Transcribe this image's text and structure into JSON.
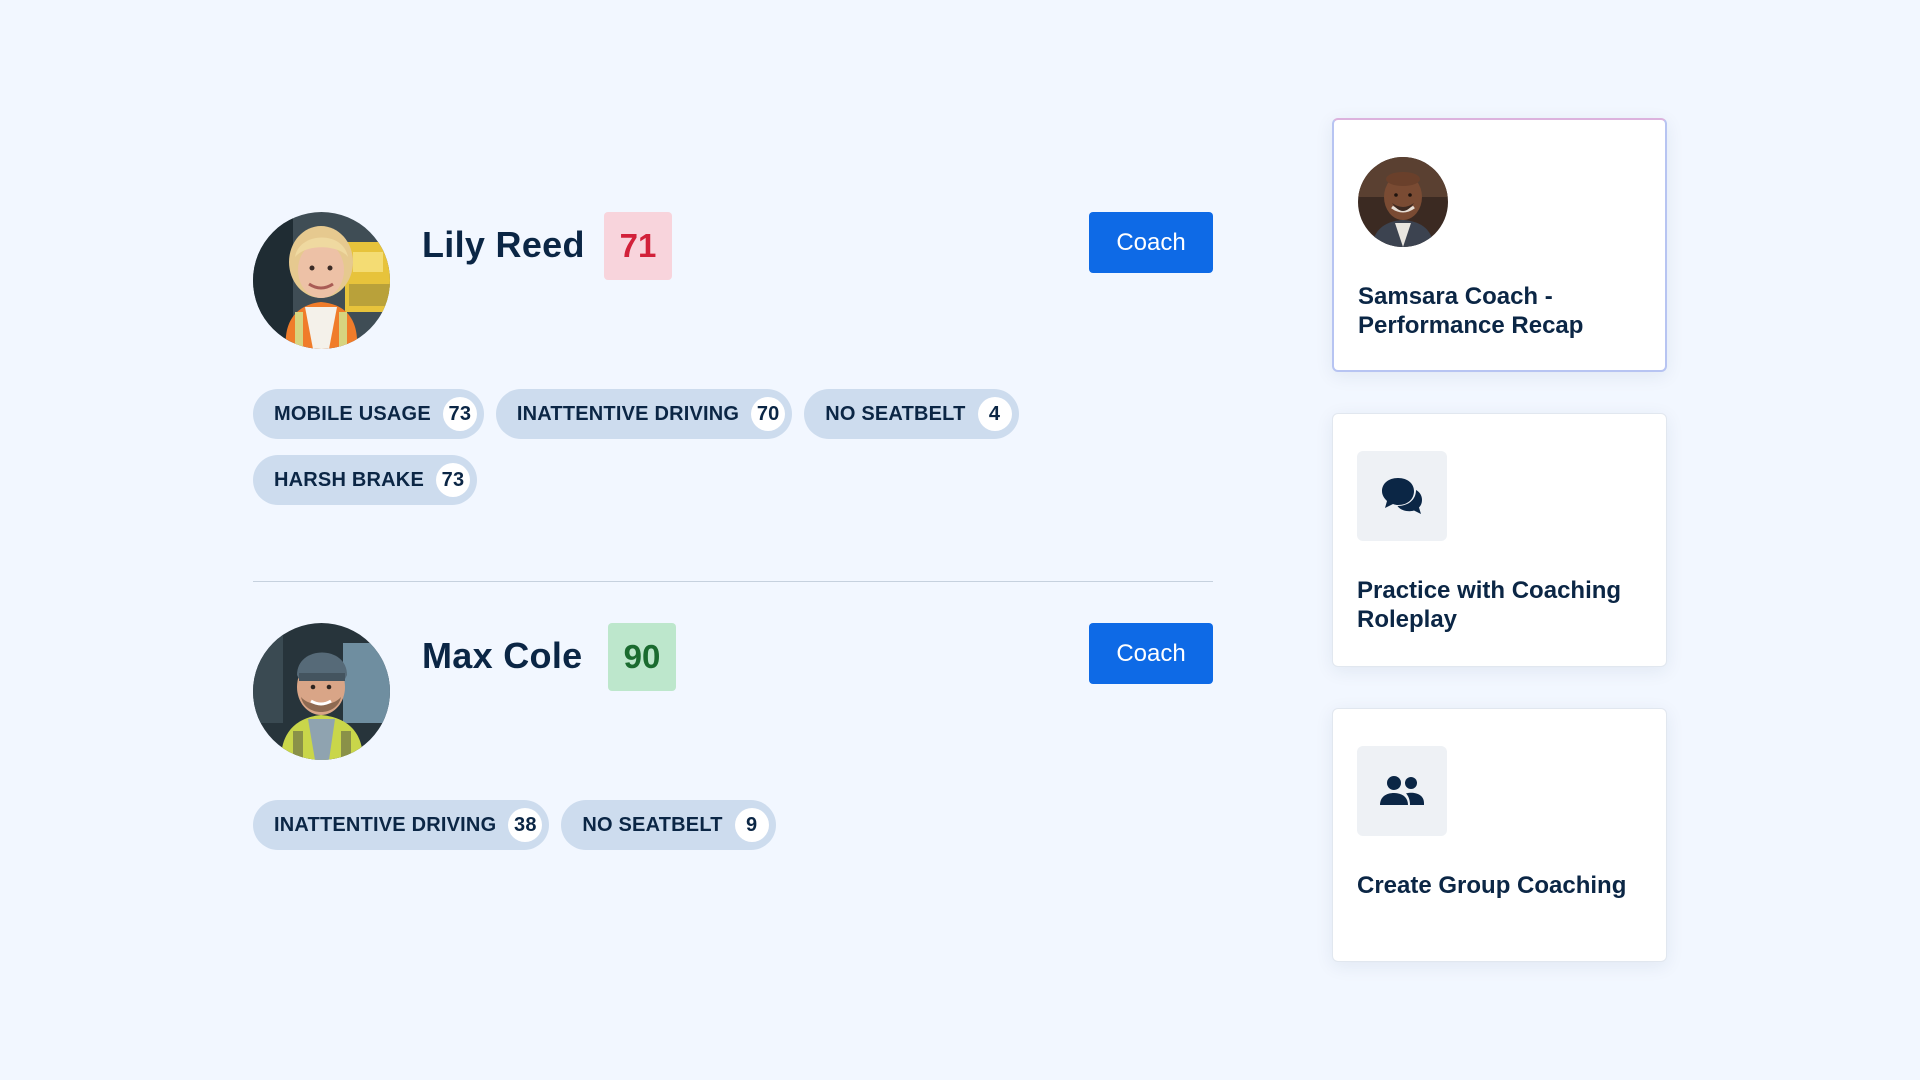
{
  "drivers": [
    {
      "name": "Lily Reed",
      "score": "71",
      "coach_label": "Coach",
      "avatar_icon": "driver-photo-lily-reed",
      "tags": [
        {
          "label": "MOBILE USAGE",
          "count": "73"
        },
        {
          "label": "INATTENTIVE DRIVING",
          "count": "70"
        },
        {
          "label": "NO SEATBELT",
          "count": "4"
        },
        {
          "label": "HARSH BRAKE",
          "count": "73"
        }
      ]
    },
    {
      "name": "Max Cole",
      "score": "90",
      "coach_label": "Coach",
      "avatar_icon": "driver-photo-max-cole",
      "tags": [
        {
          "label": "INATTENTIVE DRIVING",
          "count": "38"
        },
        {
          "label": "NO SEATBELT",
          "count": "9"
        }
      ]
    }
  ],
  "cards": [
    {
      "title": "Samsara Coach - Performance Recap",
      "icon": "coach-photo-avatar"
    },
    {
      "title": "Practice with Coaching Roleplay",
      "icon": "chat-bubbles-icon"
    },
    {
      "title": "Create Group Coaching",
      "icon": "group-people-icon"
    }
  ],
  "colors": {
    "background": "#f2f7ff",
    "primary_button": "#0e6ae6",
    "tag_bg": "#cddcee",
    "score_low_bg": "#f8d4dc",
    "score_low_text": "#d2213a",
    "score_high_bg": "#bde7cc",
    "score_high_text": "#1a6b2f",
    "text_dark": "#0b2645"
  }
}
